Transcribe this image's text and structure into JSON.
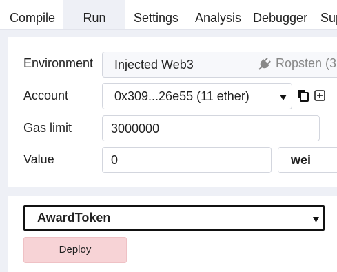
{
  "tabs": [
    {
      "label": "Compile"
    },
    {
      "label": "Run"
    },
    {
      "label": "Settings"
    },
    {
      "label": "Analysis"
    },
    {
      "label": "Debugger"
    },
    {
      "label": "Sup"
    }
  ],
  "active_tab": "Run",
  "environment": {
    "label": "Environment",
    "value": "Injected Web3",
    "network": "Ropsten (3"
  },
  "account": {
    "label": "Account",
    "value": "0x309...26e55 (11 ether)"
  },
  "gas_limit": {
    "label": "Gas limit",
    "value": "3000000"
  },
  "value": {
    "label": "Value",
    "amount": "0",
    "unit": "wei"
  },
  "contract": {
    "selected": "AwardToken"
  },
  "deploy_label": "Deploy",
  "colors": {
    "accent_tab_bg": "#eef0f6",
    "deploy_bg": "#f7d3d6",
    "page_bg": "#eef0f6"
  }
}
